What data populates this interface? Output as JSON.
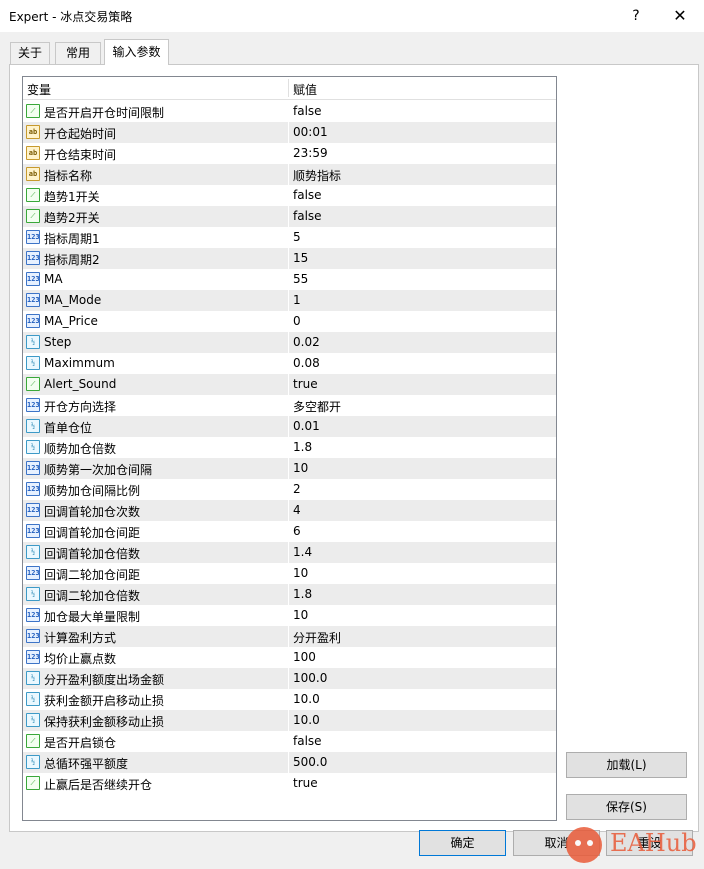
{
  "window": {
    "title": "Expert - 冰点交易策略",
    "help": "?",
    "close": "✕"
  },
  "tabs": [
    {
      "label": "关于"
    },
    {
      "label": "常用"
    },
    {
      "label": "输入参数"
    }
  ],
  "grid": {
    "col_var": "变量",
    "col_val": "赋值",
    "rows": [
      {
        "type": "bool",
        "icon": "bool-icon",
        "name": "是否开启开仓时间限制",
        "value": "false"
      },
      {
        "type": "str",
        "icon": "string-icon",
        "name": "开仓起始时间",
        "value": "00:01"
      },
      {
        "type": "str",
        "icon": "string-icon",
        "name": "开仓结束时间",
        "value": "23:59"
      },
      {
        "type": "str",
        "icon": "string-icon",
        "name": "指标名称",
        "value": "顺势指标"
      },
      {
        "type": "bool",
        "icon": "bool-icon",
        "name": "趋势1开关",
        "value": "false"
      },
      {
        "type": "bool",
        "icon": "bool-icon",
        "name": "趋势2开关",
        "value": "false"
      },
      {
        "type": "int",
        "icon": "integer-icon",
        "name": "指标周期1",
        "value": "5"
      },
      {
        "type": "int",
        "icon": "integer-icon",
        "name": "指标周期2",
        "value": "15"
      },
      {
        "type": "int",
        "icon": "integer-icon",
        "name": "MA",
        "value": "55"
      },
      {
        "type": "int",
        "icon": "integer-icon",
        "name": "MA_Mode",
        "value": "1"
      },
      {
        "type": "int",
        "icon": "integer-icon",
        "name": "MA_Price",
        "value": "0"
      },
      {
        "type": "dbl",
        "icon": "double-icon",
        "name": "Step",
        "value": "0.02"
      },
      {
        "type": "dbl",
        "icon": "double-icon",
        "name": "Maximmum",
        "value": "0.08"
      },
      {
        "type": "bool",
        "icon": "bool-icon",
        "name": "Alert_Sound",
        "value": "true"
      },
      {
        "type": "int",
        "icon": "integer-icon",
        "name": "开仓方向选择",
        "value": "多空都开"
      },
      {
        "type": "dbl",
        "icon": "double-icon",
        "name": "首单仓位",
        "value": "0.01"
      },
      {
        "type": "dbl",
        "icon": "double-icon",
        "name": "顺势加仓倍数",
        "value": "1.8"
      },
      {
        "type": "int",
        "icon": "integer-icon",
        "name": "顺势第一次加仓间隔",
        "value": "10"
      },
      {
        "type": "int",
        "icon": "integer-icon",
        "name": "顺势加仓间隔比例",
        "value": "2"
      },
      {
        "type": "int",
        "icon": "integer-icon",
        "name": "回调首轮加仓次数",
        "value": "4"
      },
      {
        "type": "int",
        "icon": "integer-icon",
        "name": "回调首轮加仓间距",
        "value": "6"
      },
      {
        "type": "dbl",
        "icon": "double-icon",
        "name": "回调首轮加仓倍数",
        "value": "1.4"
      },
      {
        "type": "int",
        "icon": "integer-icon",
        "name": "回调二轮加仓间距",
        "value": "10"
      },
      {
        "type": "dbl",
        "icon": "double-icon",
        "name": "回调二轮加仓倍数",
        "value": "1.8"
      },
      {
        "type": "int",
        "icon": "integer-icon",
        "name": "加仓最大单量限制",
        "value": "10"
      },
      {
        "type": "int",
        "icon": "integer-icon",
        "name": "计算盈利方式",
        "value": "分开盈利"
      },
      {
        "type": "int",
        "icon": "integer-icon",
        "name": "均价止赢点数",
        "value": "100"
      },
      {
        "type": "dbl",
        "icon": "double-icon",
        "name": "分开盈利额度出场金额",
        "value": "100.0"
      },
      {
        "type": "dbl",
        "icon": "double-icon",
        "name": "获利金额开启移动止损",
        "value": "10.0"
      },
      {
        "type": "dbl",
        "icon": "double-icon",
        "name": "保持获利金额移动止损",
        "value": "10.0"
      },
      {
        "type": "bool",
        "icon": "bool-icon",
        "name": "是否开启锁仓",
        "value": "false"
      },
      {
        "type": "dbl",
        "icon": "double-icon",
        "name": "总循环强平额度",
        "value": "500.0"
      },
      {
        "type": "bool",
        "icon": "bool-icon",
        "name": "止赢后是否继续开仓",
        "value": "true"
      }
    ]
  },
  "icon_glyphs": {
    "bool": "⟋",
    "str": "ab",
    "int": "123",
    "dbl": "½"
  },
  "buttons": {
    "load": "加载(L)",
    "save": "保存(S)",
    "ok": "确定",
    "cancel": "取消",
    "reset": "重设"
  },
  "watermark": {
    "text": "EAHub"
  }
}
